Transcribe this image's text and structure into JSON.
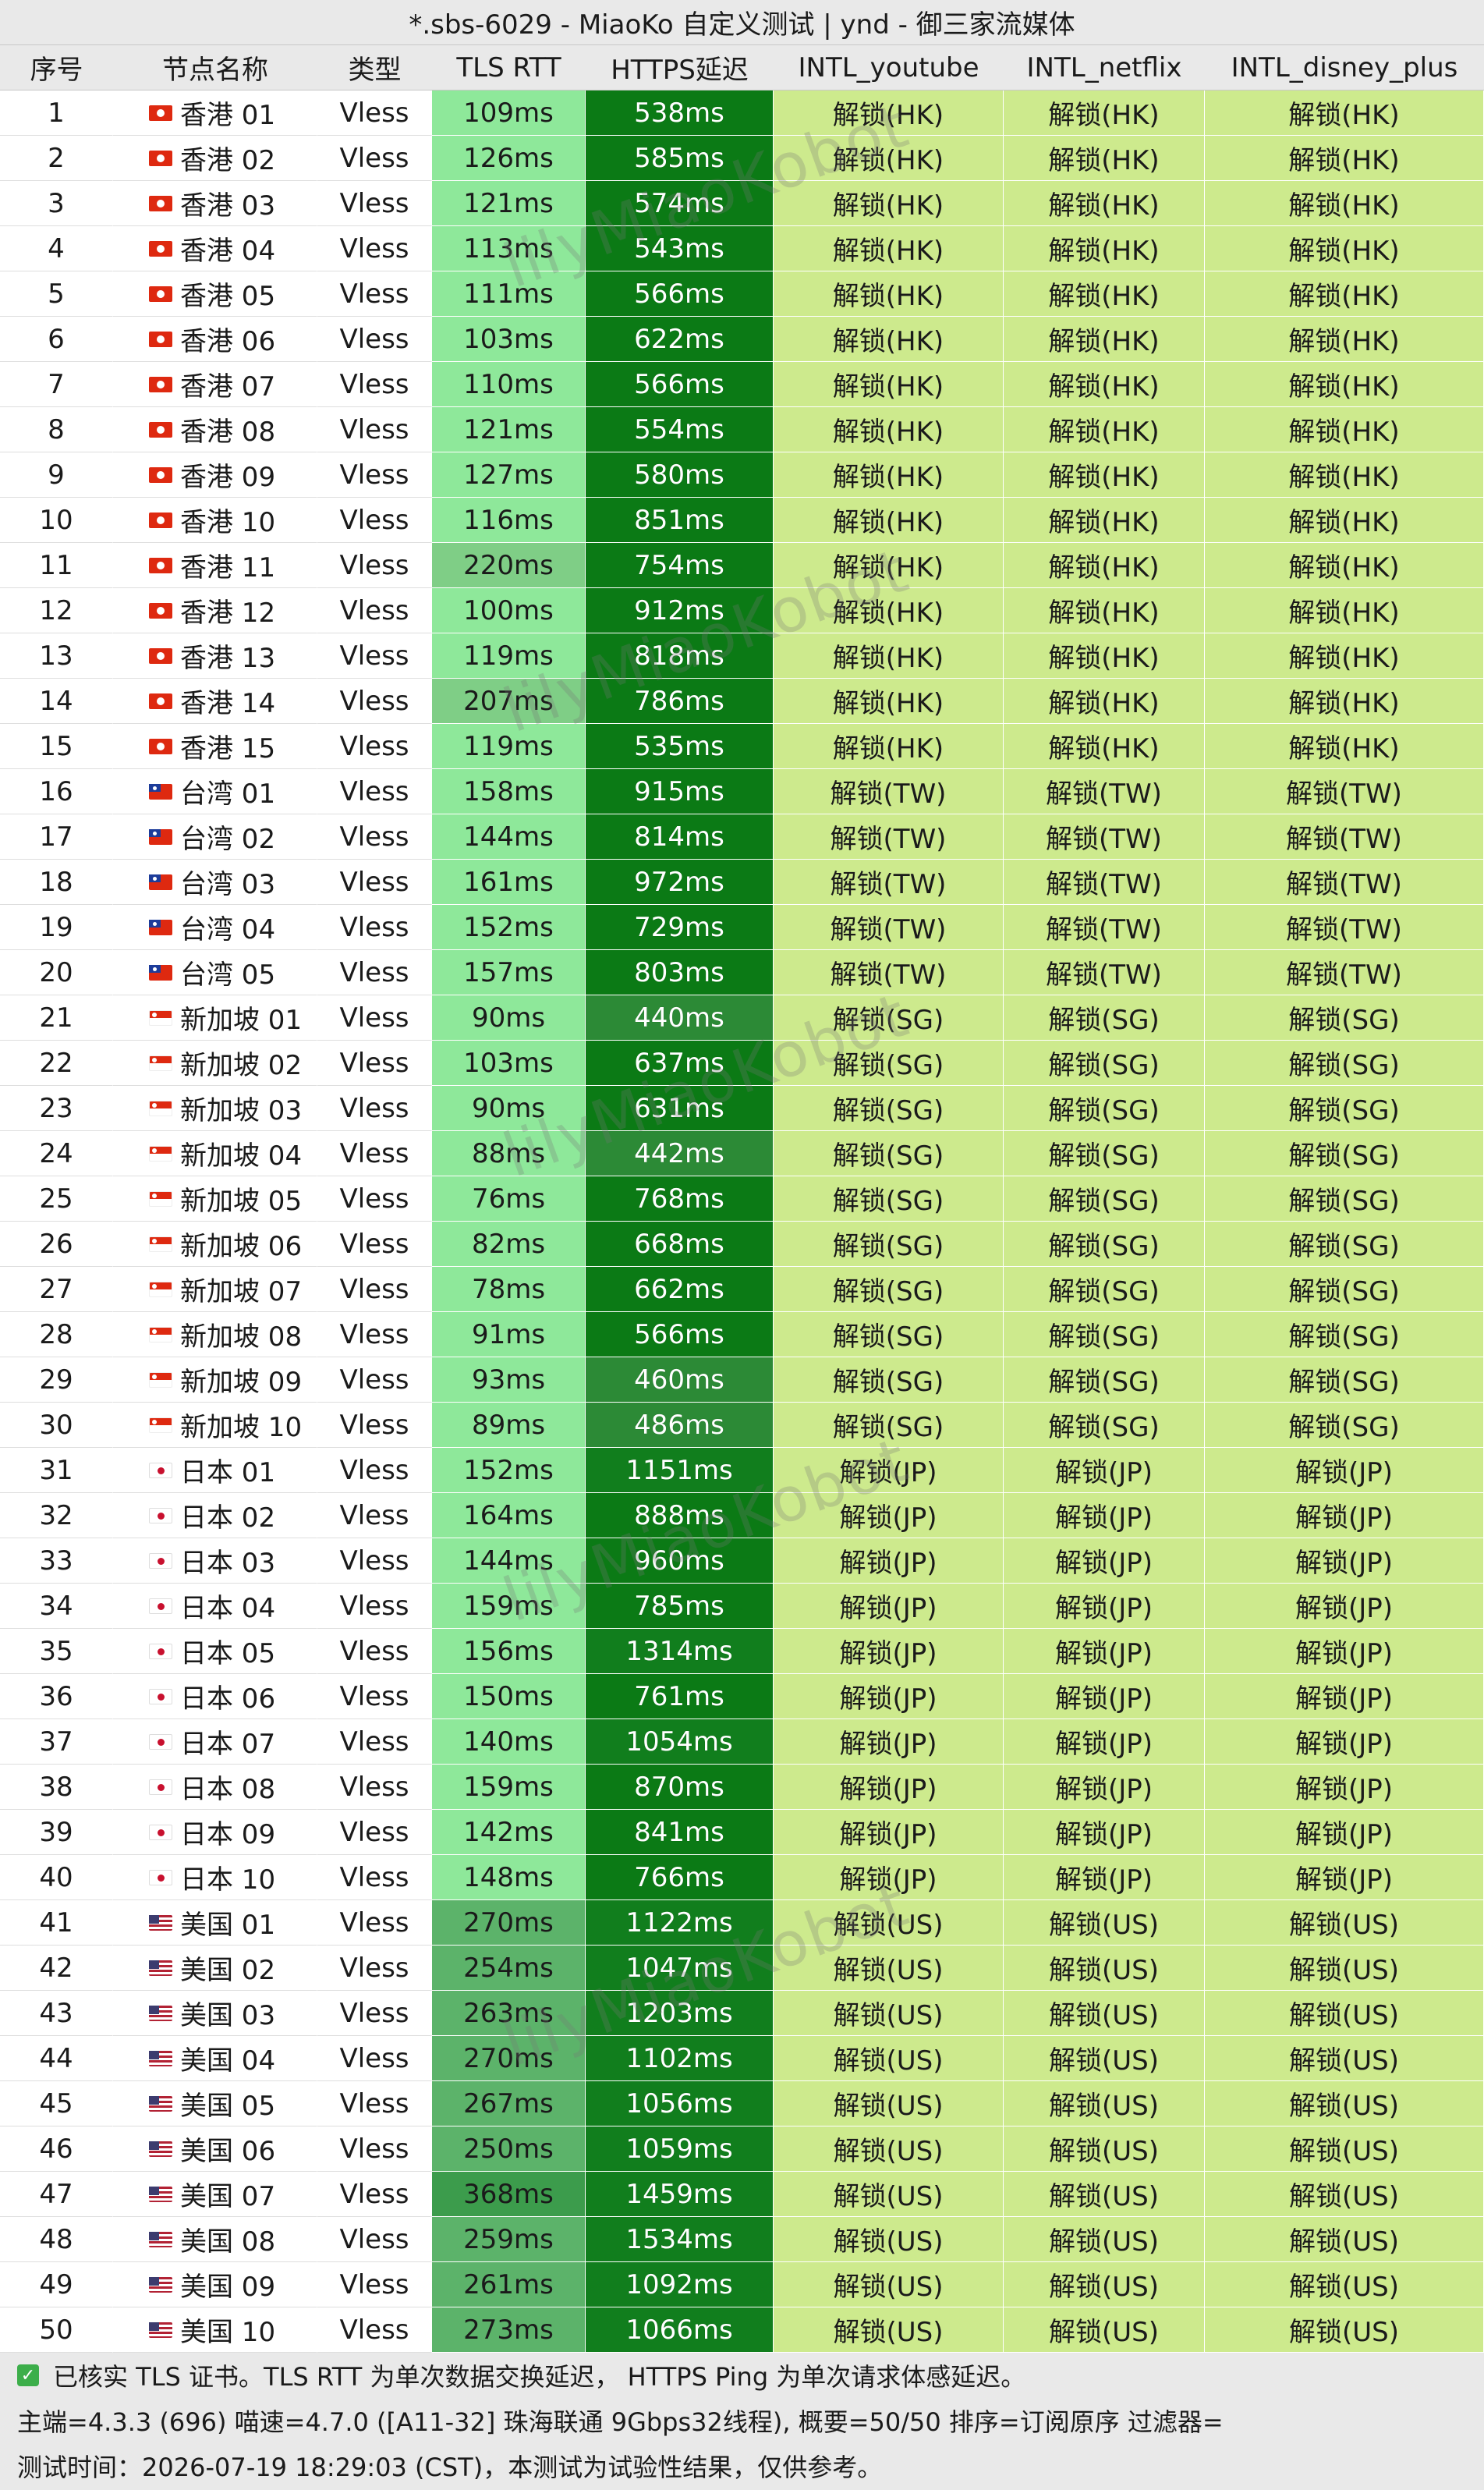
{
  "title": "*.sbs-6029 - MiaoKo 自定义测试 | ynd - 御三家流媒体",
  "headers": {
    "idx": "序号",
    "name": "节点名称",
    "type": "类型",
    "rtt": "TLS RTT",
    "ping": "HTTPS延迟",
    "youtube": "INTL_youtube",
    "netflix": "INTL_netflix",
    "disney": "INTL_disney_plus"
  },
  "watermark": "lilyMiaoKobot",
  "rows": [
    {
      "idx": "1",
      "flag": "hk",
      "name": "香港 01",
      "type": "Vless",
      "rtt": "109ms",
      "ping": "538ms",
      "yt": "解锁(HK)",
      "nf": "解锁(HK)",
      "dp": "解锁(HK)"
    },
    {
      "idx": "2",
      "flag": "hk",
      "name": "香港 02",
      "type": "Vless",
      "rtt": "126ms",
      "ping": "585ms",
      "yt": "解锁(HK)",
      "nf": "解锁(HK)",
      "dp": "解锁(HK)"
    },
    {
      "idx": "3",
      "flag": "hk",
      "name": "香港 03",
      "type": "Vless",
      "rtt": "121ms",
      "ping": "574ms",
      "yt": "解锁(HK)",
      "nf": "解锁(HK)",
      "dp": "解锁(HK)"
    },
    {
      "idx": "4",
      "flag": "hk",
      "name": "香港 04",
      "type": "Vless",
      "rtt": "113ms",
      "ping": "543ms",
      "yt": "解锁(HK)",
      "nf": "解锁(HK)",
      "dp": "解锁(HK)"
    },
    {
      "idx": "5",
      "flag": "hk",
      "name": "香港 05",
      "type": "Vless",
      "rtt": "111ms",
      "ping": "566ms",
      "yt": "解锁(HK)",
      "nf": "解锁(HK)",
      "dp": "解锁(HK)"
    },
    {
      "idx": "6",
      "flag": "hk",
      "name": "香港 06",
      "type": "Vless",
      "rtt": "103ms",
      "ping": "622ms",
      "yt": "解锁(HK)",
      "nf": "解锁(HK)",
      "dp": "解锁(HK)"
    },
    {
      "idx": "7",
      "flag": "hk",
      "name": "香港 07",
      "type": "Vless",
      "rtt": "110ms",
      "ping": "566ms",
      "yt": "解锁(HK)",
      "nf": "解锁(HK)",
      "dp": "解锁(HK)"
    },
    {
      "idx": "8",
      "flag": "hk",
      "name": "香港 08",
      "type": "Vless",
      "rtt": "121ms",
      "ping": "554ms",
      "yt": "解锁(HK)",
      "nf": "解锁(HK)",
      "dp": "解锁(HK)"
    },
    {
      "idx": "9",
      "flag": "hk",
      "name": "香港 09",
      "type": "Vless",
      "rtt": "127ms",
      "ping": "580ms",
      "yt": "解锁(HK)",
      "nf": "解锁(HK)",
      "dp": "解锁(HK)"
    },
    {
      "idx": "10",
      "flag": "hk",
      "name": "香港 10",
      "type": "Vless",
      "rtt": "116ms",
      "ping": "851ms",
      "yt": "解锁(HK)",
      "nf": "解锁(HK)",
      "dp": "解锁(HK)"
    },
    {
      "idx": "11",
      "flag": "hk",
      "name": "香港 11",
      "type": "Vless",
      "rtt": "220ms",
      "ping": "754ms",
      "yt": "解锁(HK)",
      "nf": "解锁(HK)",
      "dp": "解锁(HK)"
    },
    {
      "idx": "12",
      "flag": "hk",
      "name": "香港 12",
      "type": "Vless",
      "rtt": "100ms",
      "ping": "912ms",
      "yt": "解锁(HK)",
      "nf": "解锁(HK)",
      "dp": "解锁(HK)"
    },
    {
      "idx": "13",
      "flag": "hk",
      "name": "香港 13",
      "type": "Vless",
      "rtt": "119ms",
      "ping": "818ms",
      "yt": "解锁(HK)",
      "nf": "解锁(HK)",
      "dp": "解锁(HK)"
    },
    {
      "idx": "14",
      "flag": "hk",
      "name": "香港 14",
      "type": "Vless",
      "rtt": "207ms",
      "ping": "786ms",
      "yt": "解锁(HK)",
      "nf": "解锁(HK)",
      "dp": "解锁(HK)"
    },
    {
      "idx": "15",
      "flag": "hk",
      "name": "香港 15",
      "type": "Vless",
      "rtt": "119ms",
      "ping": "535ms",
      "yt": "解锁(HK)",
      "nf": "解锁(HK)",
      "dp": "解锁(HK)"
    },
    {
      "idx": "16",
      "flag": "tw",
      "name": "台湾 01",
      "type": "Vless",
      "rtt": "158ms",
      "ping": "915ms",
      "yt": "解锁(TW)",
      "nf": "解锁(TW)",
      "dp": "解锁(TW)"
    },
    {
      "idx": "17",
      "flag": "tw",
      "name": "台湾 02",
      "type": "Vless",
      "rtt": "144ms",
      "ping": "814ms",
      "yt": "解锁(TW)",
      "nf": "解锁(TW)",
      "dp": "解锁(TW)"
    },
    {
      "idx": "18",
      "flag": "tw",
      "name": "台湾 03",
      "type": "Vless",
      "rtt": "161ms",
      "ping": "972ms",
      "yt": "解锁(TW)",
      "nf": "解锁(TW)",
      "dp": "解锁(TW)"
    },
    {
      "idx": "19",
      "flag": "tw",
      "name": "台湾 04",
      "type": "Vless",
      "rtt": "152ms",
      "ping": "729ms",
      "yt": "解锁(TW)",
      "nf": "解锁(TW)",
      "dp": "解锁(TW)"
    },
    {
      "idx": "20",
      "flag": "tw",
      "name": "台湾 05",
      "type": "Vless",
      "rtt": "157ms",
      "ping": "803ms",
      "yt": "解锁(TW)",
      "nf": "解锁(TW)",
      "dp": "解锁(TW)"
    },
    {
      "idx": "21",
      "flag": "sg",
      "name": "新加坡 01",
      "type": "Vless",
      "rtt": "90ms",
      "ping": "440ms",
      "yt": "解锁(SG)",
      "nf": "解锁(SG)",
      "dp": "解锁(SG)"
    },
    {
      "idx": "22",
      "flag": "sg",
      "name": "新加坡 02",
      "type": "Vless",
      "rtt": "103ms",
      "ping": "637ms",
      "yt": "解锁(SG)",
      "nf": "解锁(SG)",
      "dp": "解锁(SG)"
    },
    {
      "idx": "23",
      "flag": "sg",
      "name": "新加坡 03",
      "type": "Vless",
      "rtt": "90ms",
      "ping": "631ms",
      "yt": "解锁(SG)",
      "nf": "解锁(SG)",
      "dp": "解锁(SG)"
    },
    {
      "idx": "24",
      "flag": "sg",
      "name": "新加坡 04",
      "type": "Vless",
      "rtt": "88ms",
      "ping": "442ms",
      "yt": "解锁(SG)",
      "nf": "解锁(SG)",
      "dp": "解锁(SG)"
    },
    {
      "idx": "25",
      "flag": "sg",
      "name": "新加坡 05",
      "type": "Vless",
      "rtt": "76ms",
      "ping": "768ms",
      "yt": "解锁(SG)",
      "nf": "解锁(SG)",
      "dp": "解锁(SG)"
    },
    {
      "idx": "26",
      "flag": "sg",
      "name": "新加坡 06",
      "type": "Vless",
      "rtt": "82ms",
      "ping": "668ms",
      "yt": "解锁(SG)",
      "nf": "解锁(SG)",
      "dp": "解锁(SG)"
    },
    {
      "idx": "27",
      "flag": "sg",
      "name": "新加坡 07",
      "type": "Vless",
      "rtt": "78ms",
      "ping": "662ms",
      "yt": "解锁(SG)",
      "nf": "解锁(SG)",
      "dp": "解锁(SG)"
    },
    {
      "idx": "28",
      "flag": "sg",
      "name": "新加坡 08",
      "type": "Vless",
      "rtt": "91ms",
      "ping": "566ms",
      "yt": "解锁(SG)",
      "nf": "解锁(SG)",
      "dp": "解锁(SG)"
    },
    {
      "idx": "29",
      "flag": "sg",
      "name": "新加坡 09",
      "type": "Vless",
      "rtt": "93ms",
      "ping": "460ms",
      "yt": "解锁(SG)",
      "nf": "解锁(SG)",
      "dp": "解锁(SG)"
    },
    {
      "idx": "30",
      "flag": "sg",
      "name": "新加坡 10",
      "type": "Vless",
      "rtt": "89ms",
      "ping": "486ms",
      "yt": "解锁(SG)",
      "nf": "解锁(SG)",
      "dp": "解锁(SG)"
    },
    {
      "idx": "31",
      "flag": "jp",
      "name": "日本 01",
      "type": "Vless",
      "rtt": "152ms",
      "ping": "1151ms",
      "yt": "解锁(JP)",
      "nf": "解锁(JP)",
      "dp": "解锁(JP)"
    },
    {
      "idx": "32",
      "flag": "jp",
      "name": "日本 02",
      "type": "Vless",
      "rtt": "164ms",
      "ping": "888ms",
      "yt": "解锁(JP)",
      "nf": "解锁(JP)",
      "dp": "解锁(JP)"
    },
    {
      "idx": "33",
      "flag": "jp",
      "name": "日本 03",
      "type": "Vless",
      "rtt": "144ms",
      "ping": "960ms",
      "yt": "解锁(JP)",
      "nf": "解锁(JP)",
      "dp": "解锁(JP)"
    },
    {
      "idx": "34",
      "flag": "jp",
      "name": "日本 04",
      "type": "Vless",
      "rtt": "159ms",
      "ping": "785ms",
      "yt": "解锁(JP)",
      "nf": "解锁(JP)",
      "dp": "解锁(JP)"
    },
    {
      "idx": "35",
      "flag": "jp",
      "name": "日本 05",
      "type": "Vless",
      "rtt": "156ms",
      "ping": "1314ms",
      "yt": "解锁(JP)",
      "nf": "解锁(JP)",
      "dp": "解锁(JP)"
    },
    {
      "idx": "36",
      "flag": "jp",
      "name": "日本 06",
      "type": "Vless",
      "rtt": "150ms",
      "ping": "761ms",
      "yt": "解锁(JP)",
      "nf": "解锁(JP)",
      "dp": "解锁(JP)"
    },
    {
      "idx": "37",
      "flag": "jp",
      "name": "日本 07",
      "type": "Vless",
      "rtt": "140ms",
      "ping": "1054ms",
      "yt": "解锁(JP)",
      "nf": "解锁(JP)",
      "dp": "解锁(JP)"
    },
    {
      "idx": "38",
      "flag": "jp",
      "name": "日本 08",
      "type": "Vless",
      "rtt": "159ms",
      "ping": "870ms",
      "yt": "解锁(JP)",
      "nf": "解锁(JP)",
      "dp": "解锁(JP)"
    },
    {
      "idx": "39",
      "flag": "jp",
      "name": "日本 09",
      "type": "Vless",
      "rtt": "142ms",
      "ping": "841ms",
      "yt": "解锁(JP)",
      "nf": "解锁(JP)",
      "dp": "解锁(JP)"
    },
    {
      "idx": "40",
      "flag": "jp",
      "name": "日本 10",
      "type": "Vless",
      "rtt": "148ms",
      "ping": "766ms",
      "yt": "解锁(JP)",
      "nf": "解锁(JP)",
      "dp": "解锁(JP)"
    },
    {
      "idx": "41",
      "flag": "us",
      "name": "美国 01",
      "type": "Vless",
      "rtt": "270ms",
      "ping": "1122ms",
      "yt": "解锁(US)",
      "nf": "解锁(US)",
      "dp": "解锁(US)"
    },
    {
      "idx": "42",
      "flag": "us",
      "name": "美国 02",
      "type": "Vless",
      "rtt": "254ms",
      "ping": "1047ms",
      "yt": "解锁(US)",
      "nf": "解锁(US)",
      "dp": "解锁(US)"
    },
    {
      "idx": "43",
      "flag": "us",
      "name": "美国 03",
      "type": "Vless",
      "rtt": "263ms",
      "ping": "1203ms",
      "yt": "解锁(US)",
      "nf": "解锁(US)",
      "dp": "解锁(US)"
    },
    {
      "idx": "44",
      "flag": "us",
      "name": "美国 04",
      "type": "Vless",
      "rtt": "270ms",
      "ping": "1102ms",
      "yt": "解锁(US)",
      "nf": "解锁(US)",
      "dp": "解锁(US)"
    },
    {
      "idx": "45",
      "flag": "us",
      "name": "美国 05",
      "type": "Vless",
      "rtt": "267ms",
      "ping": "1056ms",
      "yt": "解锁(US)",
      "nf": "解锁(US)",
      "dp": "解锁(US)"
    },
    {
      "idx": "46",
      "flag": "us",
      "name": "美国 06",
      "type": "Vless",
      "rtt": "250ms",
      "ping": "1059ms",
      "yt": "解锁(US)",
      "nf": "解锁(US)",
      "dp": "解锁(US)"
    },
    {
      "idx": "47",
      "flag": "us",
      "name": "美国 07",
      "type": "Vless",
      "rtt": "368ms",
      "ping": "1459ms",
      "yt": "解锁(US)",
      "nf": "解锁(US)",
      "dp": "解锁(US)"
    },
    {
      "idx": "48",
      "flag": "us",
      "name": "美国 08",
      "type": "Vless",
      "rtt": "259ms",
      "ping": "1534ms",
      "yt": "解锁(US)",
      "nf": "解锁(US)",
      "dp": "解锁(US)"
    },
    {
      "idx": "49",
      "flag": "us",
      "name": "美国 09",
      "type": "Vless",
      "rtt": "261ms",
      "ping": "1092ms",
      "yt": "解锁(US)",
      "nf": "解锁(US)",
      "dp": "解锁(US)"
    },
    {
      "idx": "50",
      "flag": "us",
      "name": "美国 10",
      "type": "Vless",
      "rtt": "273ms",
      "ping": "1066ms",
      "yt": "解锁(US)",
      "nf": "解锁(US)",
      "dp": "解锁(US)"
    }
  ],
  "footer": {
    "line1": "已核实 TLS 证书。TLS RTT 为单次数据交换延迟， HTTPS Ping 为单次请求体感延迟。",
    "line2": "主端=4.3.3 (696) 喵速=4.7.0 ([A11-32] 珠海联通 9Gbps32线程), 概要=50/50 排序=订阅原序 过滤器=",
    "line3": "测试时间：2026-07-19 18:29:03 (CST)，本测试为试验性结果，仅供参考。"
  },
  "colors": {
    "header_bg": "#e9e9e9",
    "unlock_bg": "#cdea8d",
    "check_icon": "#3cae4a"
  }
}
